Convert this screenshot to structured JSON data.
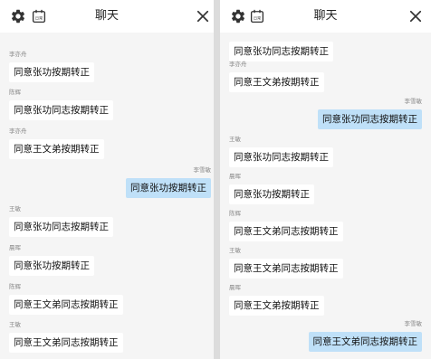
{
  "left": {
    "title": "聊天",
    "icons": {
      "settings": "gear-icon",
      "calendar": "calendar-icon",
      "close": "close-icon"
    },
    "calendar_text": "日常",
    "messages": [
      {
        "sender": "李亦舟",
        "text": "同意张功按期转正",
        "outgoing": false
      },
      {
        "sender": "陈辉",
        "text": "同意张功同志按期转正",
        "outgoing": false
      },
      {
        "sender": "李亦舟",
        "text": "同意王文弟按期转正",
        "outgoing": false
      },
      {
        "sender": "李雪敏",
        "text": "同意张功按期转正",
        "outgoing": true
      },
      {
        "sender": "王敏",
        "text": "同意张功同志按期转正",
        "outgoing": false
      },
      {
        "sender": "晨晖",
        "text": "同意张功按期转正",
        "outgoing": false
      },
      {
        "sender": "陈辉",
        "text": "同意王文弟同志按期转正",
        "outgoing": false
      },
      {
        "sender": "王敏",
        "text": "同意王文弟同志按期转正",
        "outgoing": false
      }
    ]
  },
  "right": {
    "title": "聊天",
    "icons": {
      "settings": "gear-icon",
      "calendar": "calendar-icon",
      "close": "close-icon"
    },
    "calendar_text": "日常",
    "messages": [
      {
        "sender": "",
        "text": "同意张功同志按期转正",
        "outgoing": false
      },
      {
        "sender": "李亦舟",
        "text": "同意王文弟按期转正",
        "outgoing": false
      },
      {
        "sender": "李雪敏",
        "text": "同意张功同志按期转正",
        "outgoing": true
      },
      {
        "sender": "王敏",
        "text": "同意张功同志按期转正",
        "outgoing": false
      },
      {
        "sender": "晨晖",
        "text": "同意张功按期转正",
        "outgoing": false
      },
      {
        "sender": "陈辉",
        "text": "同意王文弟同志按期转正",
        "outgoing": false
      },
      {
        "sender": "王敏",
        "text": "同意王文弟同志按期转正",
        "outgoing": false
      },
      {
        "sender": "晨晖",
        "text": "同意王文弟按期转正",
        "outgoing": false
      },
      {
        "sender": "李雪敏",
        "text": "同意王文弟同志按期转正",
        "outgoing": true
      }
    ]
  }
}
